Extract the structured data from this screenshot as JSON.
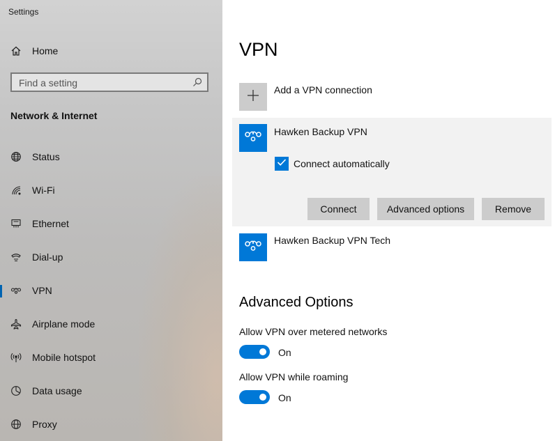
{
  "window": {
    "title": "Settings"
  },
  "sidebar": {
    "home_label": "Home",
    "search_placeholder": "Find a setting",
    "section_heading": "Network & Internet",
    "items": [
      {
        "label": "Status",
        "icon": "globe-icon",
        "selected": false
      },
      {
        "label": "Wi-Fi",
        "icon": "wifi-icon",
        "selected": false
      },
      {
        "label": "Ethernet",
        "icon": "ethernet-icon",
        "selected": false
      },
      {
        "label": "Dial-up",
        "icon": "dial-up-icon",
        "selected": false
      },
      {
        "label": "VPN",
        "icon": "vpn-icon",
        "selected": true
      },
      {
        "label": "Airplane mode",
        "icon": "airplane-icon",
        "selected": false
      },
      {
        "label": "Mobile hotspot",
        "icon": "hotspot-icon",
        "selected": false
      },
      {
        "label": "Data usage",
        "icon": "data-usage-icon",
        "selected": false
      },
      {
        "label": "Proxy",
        "icon": "proxy-icon",
        "selected": false
      }
    ]
  },
  "main": {
    "title": "VPN",
    "add_connection_label": "Add a VPN connection",
    "connections": [
      {
        "name": "Hawken Backup VPN",
        "expanded": true,
        "connect_automatically_label": "Connect automatically",
        "connect_automatically_checked": true,
        "buttons": {
          "connect": "Connect",
          "advanced": "Advanced options",
          "remove": "Remove"
        }
      },
      {
        "name": "Hawken Backup VPN Tech",
        "expanded": false
      }
    ],
    "advanced": {
      "heading": "Advanced Options",
      "metered_label": "Allow VPN over metered networks",
      "metered_state": "On",
      "roaming_label": "Allow VPN while roaming",
      "roaming_state": "On"
    }
  },
  "colors": {
    "accent": "#0078d7",
    "sidebar_bg": "#c6c6c6",
    "expanded_bg": "#f2f2f2",
    "button_bg": "#cccccc"
  }
}
